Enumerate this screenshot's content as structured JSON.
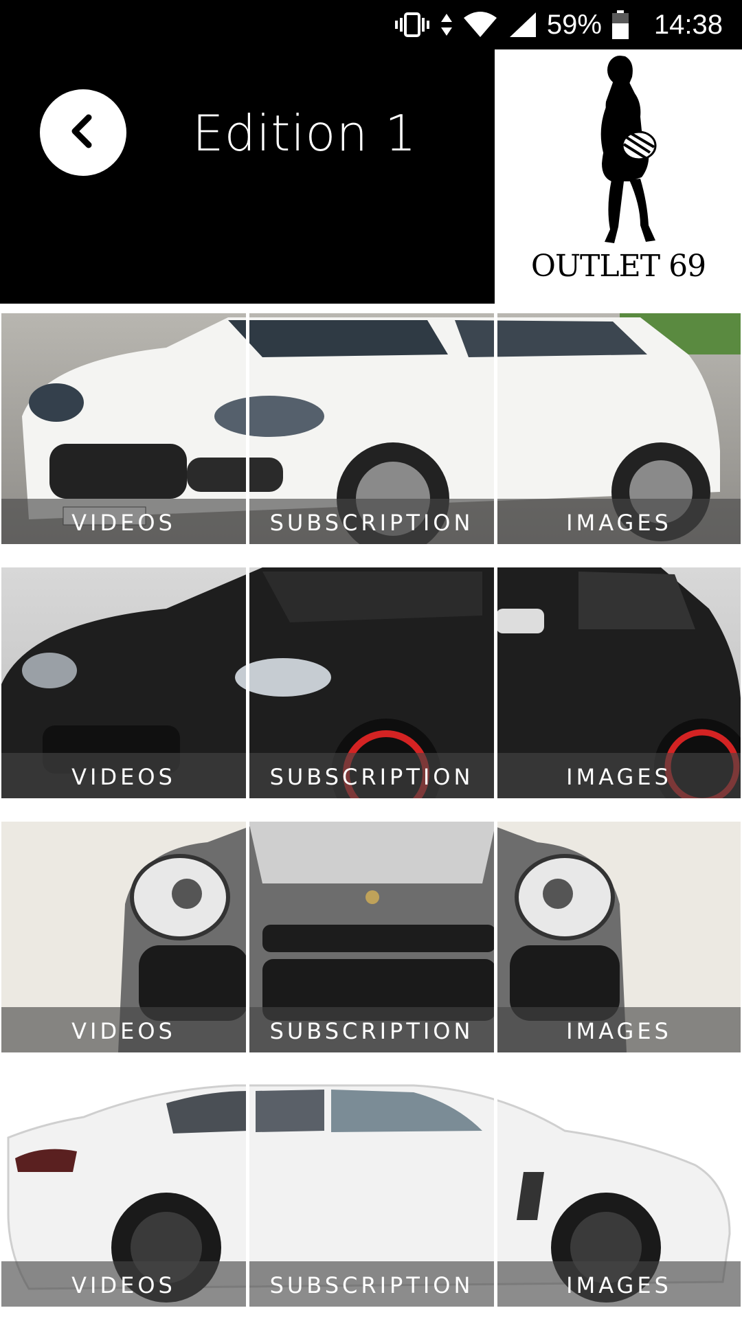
{
  "status_bar": {
    "battery": "59%",
    "time": "14:38",
    "icons": [
      "vibrate-icon",
      "data-arrows-icon",
      "wifi-icon",
      "signal-icon",
      "battery-icon"
    ]
  },
  "header": {
    "title": "Edition 1",
    "back_icon": "chevron-left-icon",
    "logo_text": "OUTLET 69"
  },
  "rows": [
    {
      "car": "white-suv",
      "tiles": [
        {
          "label": "VIDEOS"
        },
        {
          "label": "SUBSCRIPTION"
        },
        {
          "label": "IMAGES"
        }
      ]
    },
    {
      "car": "black-suv",
      "tiles": [
        {
          "label": "VIDEOS"
        },
        {
          "label": "SUBSCRIPTION"
        },
        {
          "label": "IMAGES"
        }
      ]
    },
    {
      "car": "grey-suv-front",
      "tiles": [
        {
          "label": "VIDEOS"
        },
        {
          "label": "SUBSCRIPTION"
        },
        {
          "label": "IMAGES"
        }
      ]
    },
    {
      "car": "white-sedan",
      "tiles": [
        {
          "label": "VIDEOS"
        },
        {
          "label": "SUBSCRIPTION"
        },
        {
          "label": "IMAGES"
        }
      ]
    }
  ],
  "colors": {
    "header_bg": "#000000",
    "label_overlay": "#464646",
    "label_text": "#ffffff"
  }
}
